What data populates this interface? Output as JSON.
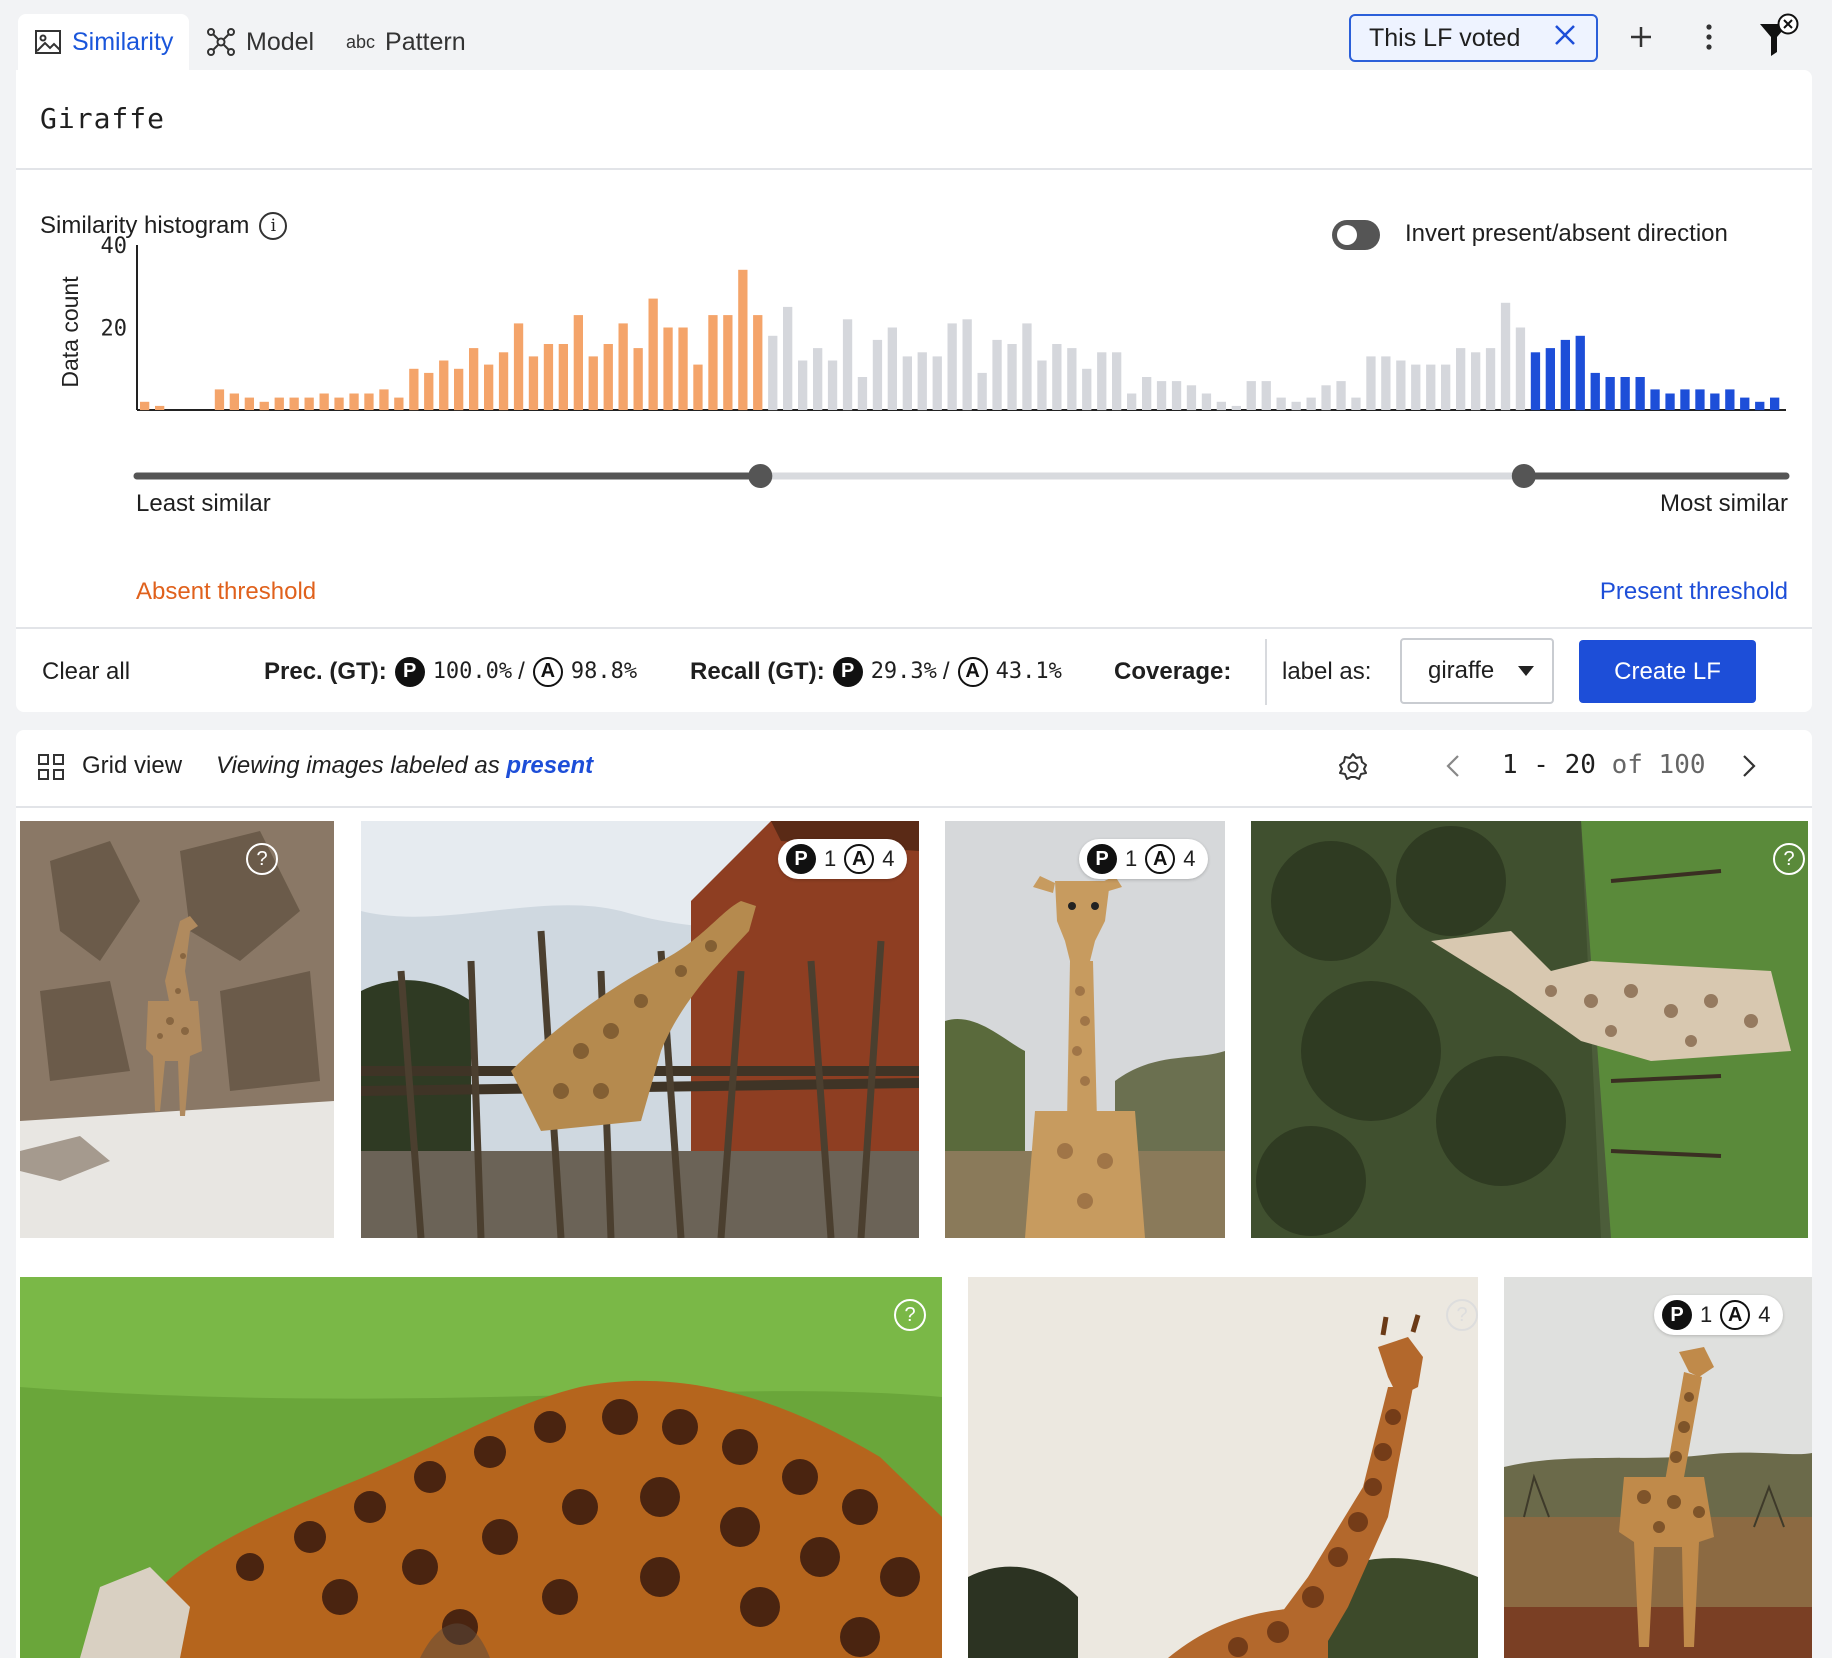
{
  "tabs": [
    {
      "label": "Similarity",
      "icon": "image-icon",
      "active": true
    },
    {
      "label": "Model",
      "icon": "model-icon",
      "active": false
    },
    {
      "label": "Pattern",
      "icon": "abc-icon",
      "active": false
    }
  ],
  "filter_chip": {
    "label": "This LF voted"
  },
  "query": {
    "text": "Giraffe"
  },
  "histogram": {
    "title": "Similarity histogram",
    "invert_label": "Invert present/absent direction",
    "invert_on": false,
    "least_label": "Least similar",
    "most_label": "Most similar",
    "absent_label": "Absent threshold",
    "present_label": "Present threshold",
    "absent_color": "#f4a46a",
    "present_color": "#1d4ed8",
    "neutral_color": "#d5d7dc",
    "absent_threshold_fraction": 0.378,
    "present_threshold_fraction": 0.841
  },
  "chart_data": {
    "type": "bar",
    "ylabel": "Data count",
    "yticks": [
      20,
      40
    ],
    "ylim": [
      0,
      40
    ],
    "values": [
      2,
      1,
      0,
      0,
      0,
      5,
      4,
      3,
      2,
      3,
      3,
      3,
      4,
      3,
      4,
      4,
      5,
      3,
      10,
      9,
      12,
      10,
      15,
      11,
      14,
      21,
      13,
      16,
      16,
      23,
      13,
      16,
      21,
      15,
      27,
      20,
      20,
      11,
      23,
      23,
      34,
      23,
      18,
      25,
      12,
      15,
      12,
      22,
      8,
      17,
      20,
      13,
      14,
      13,
      21,
      22,
      9,
      17,
      16,
      21,
      12,
      16,
      15,
      10,
      14,
      14,
      4,
      8,
      7,
      7,
      6,
      4,
      2,
      1,
      7,
      7,
      3,
      2,
      3,
      6,
      7,
      3,
      13,
      13,
      12,
      11,
      11,
      11,
      15,
      14,
      15,
      26,
      20,
      14,
      15,
      17,
      18,
      9,
      8,
      8,
      8,
      5,
      4,
      5,
      5,
      4,
      5,
      3,
      2,
      3
    ]
  },
  "metrics": {
    "clear_all": "Clear all",
    "prec_label": "Prec. (GT):",
    "prec_p": "100.0%",
    "prec_a": "98.8%",
    "recall_label": "Recall (GT):",
    "recall_p": "29.3%",
    "recall_a": "43.1%",
    "coverage_label": "Coverage:",
    "label_as": "label as:",
    "label_value": "giraffe",
    "create_label": "Create LF",
    "sep": "/",
    "p": "P",
    "a": "A"
  },
  "grid": {
    "view_label": "Grid view",
    "viewing_prefix": "Viewing images labeled as",
    "viewing_value": "present",
    "pager_range": "1 - 20",
    "pager_of": "of",
    "pager_total": "100"
  },
  "images": [
    {
      "name": "giraffe-rock-enclosure",
      "badge": null
    },
    {
      "name": "giraffe-barn-fence",
      "badge": {
        "p": "1",
        "a": "4"
      }
    },
    {
      "name": "giraffe-front-portrait",
      "badge": {
        "p": "1",
        "a": "4"
      }
    },
    {
      "name": "giraffe-rotated-field",
      "badge": null
    },
    {
      "name": "giraffe-grazing-closeup",
      "badge": null
    },
    {
      "name": "giraffe-neck-sky",
      "badge": null
    },
    {
      "name": "giraffe-savanna",
      "badge": {
        "p": "1",
        "a": "4"
      }
    }
  ]
}
